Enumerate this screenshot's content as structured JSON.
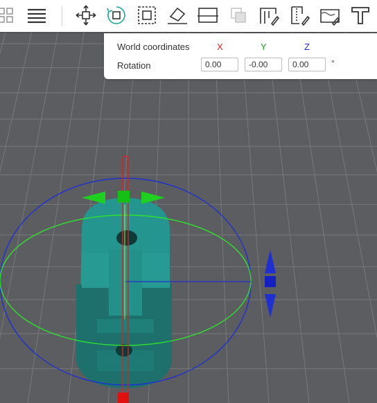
{
  "toolbar": {
    "tools": [
      {
        "name": "arrange-icon",
        "label": "Arrange"
      },
      {
        "name": "list-icon",
        "label": "Object list"
      },
      {
        "name": "move-icon",
        "label": "Move"
      },
      {
        "name": "rotate-icon",
        "label": "Rotate",
        "active": true
      },
      {
        "name": "scale-icon",
        "label": "Scale"
      },
      {
        "name": "lay-on-face-icon",
        "label": "Lay on face"
      },
      {
        "name": "cut-icon",
        "label": "Cut"
      },
      {
        "name": "mesh-boolean-icon",
        "label": "Mesh boolean"
      },
      {
        "name": "support-paint-icon",
        "label": "Support painting"
      },
      {
        "name": "seam-paint-icon",
        "label": "Seam painting"
      },
      {
        "name": "fuzzy-skin-icon",
        "label": "Fuzzy skin painting"
      },
      {
        "name": "text-icon",
        "label": "Text"
      }
    ]
  },
  "rotation_panel": {
    "coord_label": "World coordinates",
    "x_label": "X",
    "y_label": "Y",
    "z_label": "Z",
    "rotation_label": "Rotation",
    "x_value": "0.00",
    "y_value": "-0.00",
    "z_value": "0.00",
    "unit": "°"
  },
  "colors": {
    "x_axis": "#e02020",
    "y_axis": "#1aa01a",
    "z_axis": "#1f2fd0",
    "model": "#1e8f88",
    "grid": "#7a7c7f",
    "background": "#5b5d60"
  }
}
